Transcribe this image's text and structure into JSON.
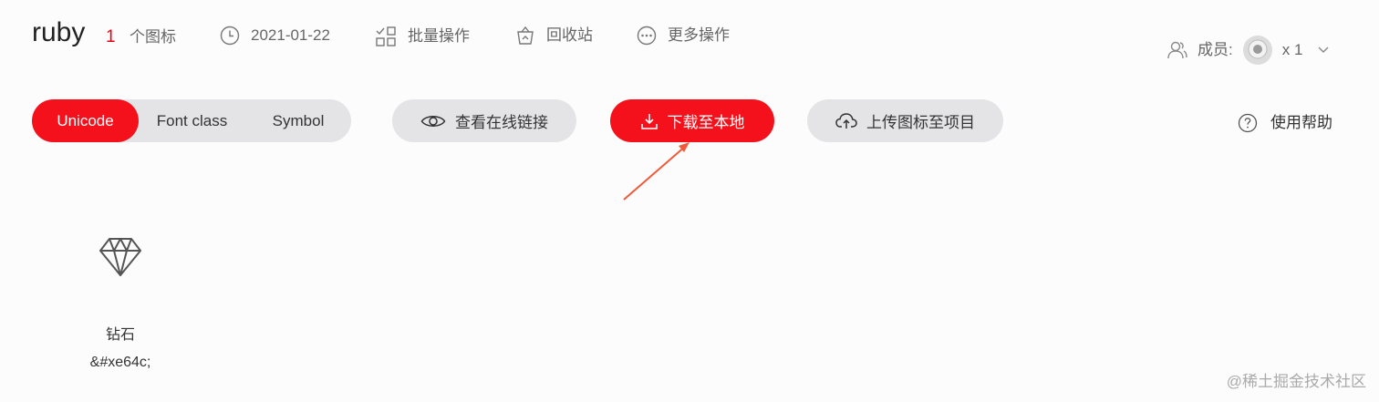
{
  "project": {
    "name": "ruby",
    "icon_count": "1",
    "icon_count_label": "个图标"
  },
  "header": {
    "date": "2021-01-22",
    "batch_label": "批量操作",
    "recycle_label": "回收站",
    "more_label": "更多操作",
    "members_label": "成员:",
    "members_count": "x 1"
  },
  "tabs": [
    {
      "label": "Unicode",
      "active": true
    },
    {
      "label": "Font class",
      "active": false
    },
    {
      "label": "Symbol",
      "active": false
    }
  ],
  "actions": {
    "view_online": "查看在线链接",
    "download": "下载至本地",
    "upload": "上传图标至项目",
    "help": "使用帮助"
  },
  "icons": [
    {
      "name": "钻石",
      "code": "&#xe64c;",
      "glyph": "diamond-icon"
    }
  ],
  "colors": {
    "accent": "#f4111c",
    "count": "#e60012",
    "pill_gray": "#e4e4e6",
    "arrow": "#f05a3a"
  },
  "watermark": "@稀土掘金技术社区"
}
